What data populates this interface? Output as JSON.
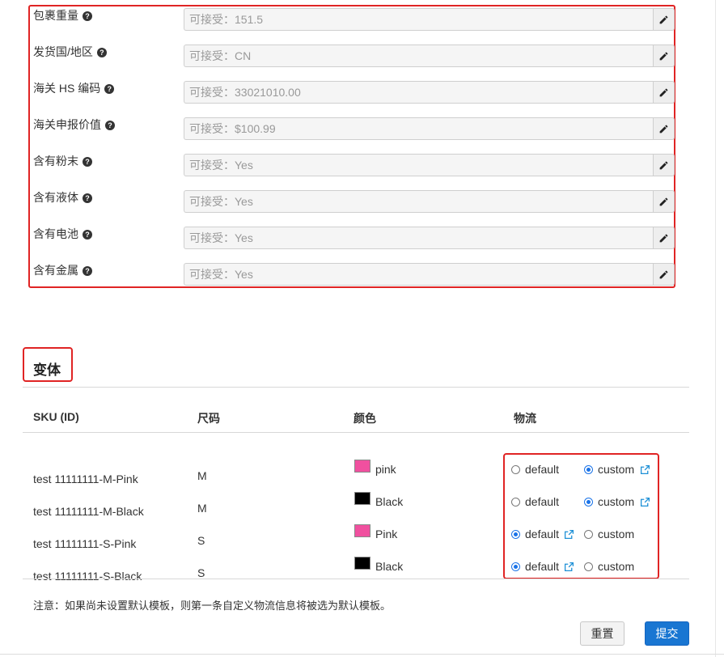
{
  "attributes": [
    {
      "label": "包裹重量",
      "value": "可接受：151.5"
    },
    {
      "label": "发货国/地区",
      "value": "可接受：CN"
    },
    {
      "label": "海关 HS 编码",
      "value": "可接受：33021010.00"
    },
    {
      "label": "海关申报价值",
      "value": "可接受：$100.99"
    },
    {
      "label": "含有粉末",
      "value": "可接受：Yes"
    },
    {
      "label": "含有液体",
      "value": "可接受：Yes"
    },
    {
      "label": "含有电池",
      "value": "可接受：Yes"
    },
    {
      "label": "含有金属",
      "value": "可接受：Yes"
    }
  ],
  "variants": {
    "title": "变体",
    "headers": {
      "sku": "SKU (ID)",
      "size": "尺码",
      "color": "颜色",
      "logistics": "物流"
    },
    "rows": [
      {
        "sku": "test 11111111-M-Pink",
        "size": "M",
        "color": "pink",
        "swatch": "#f0509f",
        "selected": "custom"
      },
      {
        "sku": "test 11111111-M-Black",
        "size": "M",
        "color": "Black",
        "swatch": "#000000",
        "selected": "custom"
      },
      {
        "sku": "test 11111111-S-Pink",
        "size": "S",
        "color": "Pink",
        "swatch": "#f0509f",
        "selected": "default"
      },
      {
        "sku": "test 11111111-S-Black",
        "size": "S",
        "color": "Black",
        "swatch": "#000000",
        "selected": "default"
      }
    ],
    "option_default": "default",
    "option_custom": "custom"
  },
  "note": "注意：如果尚未设置默认模板，则第一条自定义物流信息将被选为默认模板。",
  "buttons": {
    "reset": "重置",
    "submit": "提交"
  },
  "colors": {
    "highlight": "#e02424",
    "primary": "#1976d2",
    "link_icon": "#1e90d6"
  },
  "icons": {
    "help": "help-circle-icon",
    "edit": "pencil-icon",
    "external": "external-link-icon"
  }
}
